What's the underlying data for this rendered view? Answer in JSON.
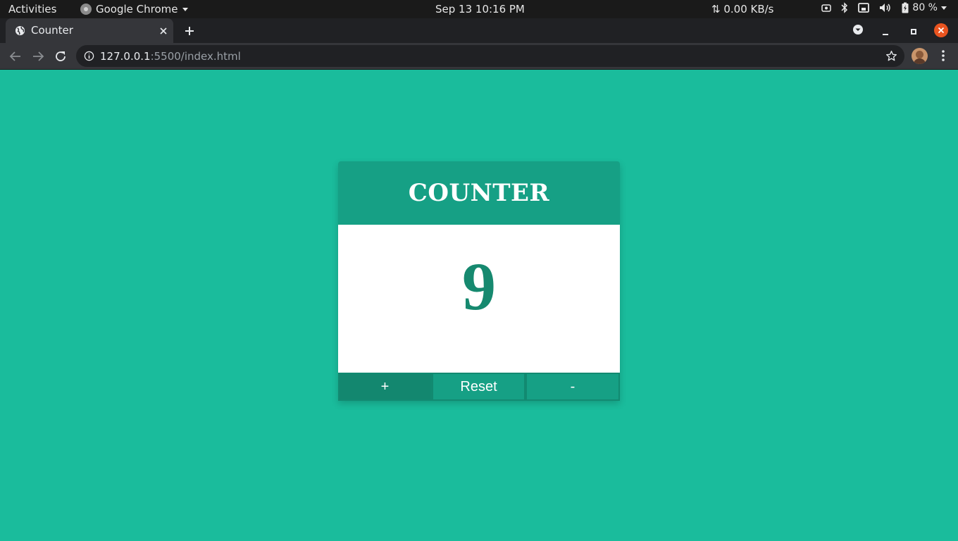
{
  "system_bar": {
    "activities": "Activities",
    "app_name": "Google Chrome",
    "clock": "Sep 13  10:16 PM",
    "network_speed": "⇅ 0.00 KB/s",
    "battery": "80 %"
  },
  "browser": {
    "tab_title": "Counter",
    "url_host": "127.0.0.1",
    "url_rest": ":5500/index.html"
  },
  "counter": {
    "title": "COUNTER",
    "value": "9",
    "increment_label": "+",
    "reset_label": "Reset",
    "decrement_label": "-"
  },
  "colors": {
    "page_background": "#1abc9c",
    "header_background": "#16a085",
    "count_text": "#16896f"
  }
}
